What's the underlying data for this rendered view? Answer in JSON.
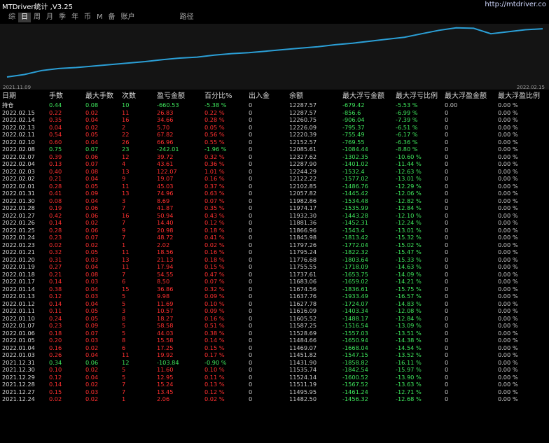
{
  "header": {
    "title": "MTDriver统计 ,V3.25",
    "url": "http://mtdriver.co"
  },
  "tabs": [
    {
      "label": "综"
    },
    {
      "label": "日"
    },
    {
      "label": "周"
    },
    {
      "label": "月"
    },
    {
      "label": "季"
    },
    {
      "label": "年"
    },
    {
      "label": "币"
    },
    {
      "label": "M"
    },
    {
      "label": "备"
    },
    {
      "label": "账户"
    },
    {
      "label": "路径"
    }
  ],
  "active_tab": "日",
  "chart": {
    "start_date": "2021.11.09",
    "end_date": "2022.02.15",
    "line_color": "#2b9fd6",
    "values": [
      0.0,
      0.05,
      0.13,
      0.17,
      0.19,
      0.22,
      0.25,
      0.28,
      0.31,
      0.35,
      0.38,
      0.4,
      0.44,
      0.47,
      0.49,
      0.52,
      0.55,
      0.58,
      0.61,
      0.65,
      0.68,
      0.72,
      0.76,
      0.8,
      0.87,
      0.94,
      0.99,
      0.98,
      0.87,
      0.91,
      0.95,
      0.97
    ]
  },
  "table": {
    "headers": [
      "日期",
      "手数",
      "最大手数",
      "次数",
      "盈亏金额",
      "百分比%",
      "出入金",
      "余额",
      "最大浮亏金额",
      "最大浮亏比例",
      "最大浮盈金额",
      "最大浮盈比例"
    ],
    "rows": [
      {
        "date": "持仓",
        "lots": "0.44",
        "maxlots": "0.08",
        "count": "10",
        "pnl": "-660.53",
        "pct": "-5.38 %",
        "io": "0",
        "bal": "12287.57",
        "mdd": "-679.42",
        "mddp": "-5.53 %",
        "mfe": "0.00",
        "mfep": "0.00 %",
        "hold": true
      },
      {
        "date": "2022.02.15",
        "lots": "0.22",
        "maxlots": "0.02",
        "count": "11",
        "pnl": "26.83",
        "pct": "0.22 %",
        "io": "0",
        "bal": "12287.57",
        "mdd": "-856.6",
        "mddp": "-6.99 %",
        "mfe": "0",
        "mfep": "0.00 %"
      },
      {
        "date": "2022.02.14",
        "lots": "0.35",
        "maxlots": "0.04",
        "count": "16",
        "pnl": "34.66",
        "pct": "0.28 %",
        "io": "0",
        "bal": "12260.75",
        "mdd": "-906.04",
        "mddp": "-7.39 %",
        "mfe": "0",
        "mfep": "0.00 %"
      },
      {
        "date": "2022.02.13",
        "lots": "0.04",
        "maxlots": "0.02",
        "count": "2",
        "pnl": "5.70",
        "pct": "0.05 %",
        "io": "0",
        "bal": "12226.09",
        "mdd": "-795.37",
        "mddp": "-6.51 %",
        "mfe": "0",
        "mfep": "0.00 %"
      },
      {
        "date": "2022.02.11",
        "lots": "0.54",
        "maxlots": "0.05",
        "count": "22",
        "pnl": "67.82",
        "pct": "0.56 %",
        "io": "0",
        "bal": "12220.39",
        "mdd": "-755.49",
        "mddp": "-6.17 %",
        "mfe": "0",
        "mfep": "0.00 %"
      },
      {
        "date": "2022.02.10",
        "lots": "0.60",
        "maxlots": "0.04",
        "count": "26",
        "pnl": "66.96",
        "pct": "0.55 %",
        "io": "0",
        "bal": "12152.57",
        "mdd": "-769.55",
        "mddp": "-6.36 %",
        "mfe": "0",
        "mfep": "0.00 %"
      },
      {
        "date": "2022.02.08",
        "lots": "0.75",
        "maxlots": "0.07",
        "count": "23",
        "pnl": "-242.01",
        "pct": "-1.96 %",
        "io": "0",
        "bal": "12085.61",
        "mdd": "-1084.44",
        "mddp": "-8.80 %",
        "mfe": "0",
        "mfep": "0.00 %"
      },
      {
        "date": "2022.02.07",
        "lots": "0.39",
        "maxlots": "0.06",
        "count": "12",
        "pnl": "39.72",
        "pct": "0.32 %",
        "io": "0",
        "bal": "12327.62",
        "mdd": "-1302.35",
        "mddp": "-10.60 %",
        "mfe": "0",
        "mfep": "0.00 %"
      },
      {
        "date": "2022.02.04",
        "lots": "0.13",
        "maxlots": "0.07",
        "count": "4",
        "pnl": "43.61",
        "pct": "0.36 %",
        "io": "0",
        "bal": "12287.90",
        "mdd": "-1401.02",
        "mddp": "-11.44 %",
        "mfe": "0",
        "mfep": "0.00 %"
      },
      {
        "date": "2022.02.03",
        "lots": "0.40",
        "maxlots": "0.08",
        "count": "13",
        "pnl": "122.07",
        "pct": "1.01 %",
        "io": "0",
        "bal": "12244.29",
        "mdd": "-1532.4",
        "mddp": "-12.63 %",
        "mfe": "0",
        "mfep": "0.00 %"
      },
      {
        "date": "2022.02.02",
        "lots": "0.21",
        "maxlots": "0.04",
        "count": "9",
        "pnl": "19.07",
        "pct": "0.16 %",
        "io": "0",
        "bal": "12122.22",
        "mdd": "-1577.02",
        "mddp": "-13.01 %",
        "mfe": "0",
        "mfep": "0.00 %"
      },
      {
        "date": "2022.02.01",
        "lots": "0.28",
        "maxlots": "0.05",
        "count": "11",
        "pnl": "45.03",
        "pct": "0.37 %",
        "io": "0",
        "bal": "12102.85",
        "mdd": "-1486.76",
        "mddp": "-12.29 %",
        "mfe": "0",
        "mfep": "0.00 %"
      },
      {
        "date": "2022.01.31",
        "lots": "0.41",
        "maxlots": "0.09",
        "count": "13",
        "pnl": "74.96",
        "pct": "0.63 %",
        "io": "0",
        "bal": "12057.82",
        "mdd": "-1445.42",
        "mddp": "-12.06 %",
        "mfe": "0",
        "mfep": "0.00 %"
      },
      {
        "date": "2022.01.30",
        "lots": "0.08",
        "maxlots": "0.04",
        "count": "3",
        "pnl": "8.69",
        "pct": "0.07 %",
        "io": "0",
        "bal": "11982.86",
        "mdd": "-1534.48",
        "mddp": "-12.82 %",
        "mfe": "0",
        "mfep": "0.00 %"
      },
      {
        "date": "2022.01.28",
        "lots": "0.19",
        "maxlots": "0.06",
        "count": "7",
        "pnl": "41.87",
        "pct": "0.35 %",
        "io": "0",
        "bal": "11974.17",
        "mdd": "-1535.99",
        "mddp": "-12.84 %",
        "mfe": "0",
        "mfep": "0.00 %"
      },
      {
        "date": "2022.01.27",
        "lots": "0.42",
        "maxlots": "0.06",
        "count": "16",
        "pnl": "50.94",
        "pct": "0.43 %",
        "io": "0",
        "bal": "11932.30",
        "mdd": "-1443.28",
        "mddp": "-12.10 %",
        "mfe": "0",
        "mfep": "0.00 %"
      },
      {
        "date": "2022.01.26",
        "lots": "0.14",
        "maxlots": "0.02",
        "count": "7",
        "pnl": "14.40",
        "pct": "0.12 %",
        "io": "0",
        "bal": "11881.36",
        "mdd": "-1452.31",
        "mddp": "-12.24 %",
        "mfe": "0",
        "mfep": "0.00 %"
      },
      {
        "date": "2022.01.25",
        "lots": "0.28",
        "maxlots": "0.06",
        "count": "9",
        "pnl": "20.98",
        "pct": "0.18 %",
        "io": "0",
        "bal": "11866.96",
        "mdd": "-1543.4",
        "mddp": "-13.01 %",
        "mfe": "0",
        "mfep": "0.00 %"
      },
      {
        "date": "2022.01.24",
        "lots": "0.23",
        "maxlots": "0.07",
        "count": "7",
        "pnl": "48.72",
        "pct": "0.41 %",
        "io": "0",
        "bal": "11845.98",
        "mdd": "-1813.42",
        "mddp": "-15.32 %",
        "mfe": "0",
        "mfep": "0.00 %"
      },
      {
        "date": "2022.01.23",
        "lots": "0.02",
        "maxlots": "0.02",
        "count": "1",
        "pnl": "2.02",
        "pct": "0.02 %",
        "io": "0",
        "bal": "11797.26",
        "mdd": "-1772.04",
        "mddp": "-15.02 %",
        "mfe": "0",
        "mfep": "0.00 %"
      },
      {
        "date": "2022.01.21",
        "lots": "0.32",
        "maxlots": "0.05",
        "count": "11",
        "pnl": "18.56",
        "pct": "0.16 %",
        "io": "0",
        "bal": "11795.24",
        "mdd": "-1822.32",
        "mddp": "-15.47 %",
        "mfe": "0",
        "mfep": "0.00 %"
      },
      {
        "date": "2022.01.20",
        "lots": "0.31",
        "maxlots": "0.03",
        "count": "13",
        "pnl": "21.13",
        "pct": "0.18 %",
        "io": "0",
        "bal": "11776.68",
        "mdd": "-1803.64",
        "mddp": "-15.33 %",
        "mfe": "0",
        "mfep": "0.00 %"
      },
      {
        "date": "2022.01.19",
        "lots": "0.27",
        "maxlots": "0.04",
        "count": "11",
        "pnl": "17.94",
        "pct": "0.15 %",
        "io": "0",
        "bal": "11755.55",
        "mdd": "-1718.09",
        "mddp": "-14.63 %",
        "mfe": "0",
        "mfep": "0.00 %"
      },
      {
        "date": "2022.01.18",
        "lots": "0.21",
        "maxlots": "0.08",
        "count": "7",
        "pnl": "54.55",
        "pct": "0.47 %",
        "io": "0",
        "bal": "11737.61",
        "mdd": "-1653.75",
        "mddp": "-14.09 %",
        "mfe": "0",
        "mfep": "0.00 %"
      },
      {
        "date": "2022.01.17",
        "lots": "0.14",
        "maxlots": "0.03",
        "count": "6",
        "pnl": "8.50",
        "pct": "0.07 %",
        "io": "0",
        "bal": "11683.06",
        "mdd": "-1659.02",
        "mddp": "-14.21 %",
        "mfe": "0",
        "mfep": "0.00 %"
      },
      {
        "date": "2022.01.14",
        "lots": "0.38",
        "maxlots": "0.04",
        "count": "15",
        "pnl": "36.86",
        "pct": "0.32 %",
        "io": "0",
        "bal": "11674.56",
        "mdd": "-1836.61",
        "mddp": "-15.75 %",
        "mfe": "0",
        "mfep": "0.00 %"
      },
      {
        "date": "2022.01.13",
        "lots": "0.12",
        "maxlots": "0.03",
        "count": "5",
        "pnl": "9.98",
        "pct": "0.09 %",
        "io": "0",
        "bal": "11637.76",
        "mdd": "-1933.49",
        "mddp": "-16.57 %",
        "mfe": "0",
        "mfep": "0.00 %"
      },
      {
        "date": "2022.01.12",
        "lots": "0.14",
        "maxlots": "0.04",
        "count": "5",
        "pnl": "11.69",
        "pct": "0.10 %",
        "io": "0",
        "bal": "11627.78",
        "mdd": "-1724.07",
        "mddp": "-14.83 %",
        "mfe": "0",
        "mfep": "0.00 %"
      },
      {
        "date": "2022.01.11",
        "lots": "0.11",
        "maxlots": "0.05",
        "count": "3",
        "pnl": "10.57",
        "pct": "0.09 %",
        "io": "0",
        "bal": "11616.09",
        "mdd": "-1403.34",
        "mddp": "-12.08 %",
        "mfe": "0",
        "mfep": "0.00 %"
      },
      {
        "date": "2022.01.10",
        "lots": "0.24",
        "maxlots": "0.05",
        "count": "8",
        "pnl": "18.27",
        "pct": "0.16 %",
        "io": "0",
        "bal": "11605.52",
        "mdd": "-1488.17",
        "mddp": "-12.84 %",
        "mfe": "0",
        "mfep": "0.00 %"
      },
      {
        "date": "2022.01.07",
        "lots": "0.23",
        "maxlots": "0.09",
        "count": "5",
        "pnl": "58.58",
        "pct": "0.51 %",
        "io": "0",
        "bal": "11587.25",
        "mdd": "-1516.54",
        "mddp": "-13.09 %",
        "mfe": "0",
        "mfep": "0.00 %"
      },
      {
        "date": "2022.01.06",
        "lots": "0.18",
        "maxlots": "0.07",
        "count": "5",
        "pnl": "44.03",
        "pct": "0.38 %",
        "io": "0",
        "bal": "11528.69",
        "mdd": "-1557.03",
        "mddp": "-13.51 %",
        "mfe": "0",
        "mfep": "0.00 %"
      },
      {
        "date": "2022.01.05",
        "lots": "0.20",
        "maxlots": "0.03",
        "count": "8",
        "pnl": "15.58",
        "pct": "0.14 %",
        "io": "0",
        "bal": "11484.66",
        "mdd": "-1650.94",
        "mddp": "-14.38 %",
        "mfe": "0",
        "mfep": "0.00 %"
      },
      {
        "date": "2022.01.04",
        "lots": "0.16",
        "maxlots": "0.02",
        "count": "6",
        "pnl": "17.25",
        "pct": "0.15 %",
        "io": "0",
        "bal": "11469.07",
        "mdd": "-1668.04",
        "mddp": "-14.54 %",
        "mfe": "0",
        "mfep": "0.00 %"
      },
      {
        "date": "2022.01.03",
        "lots": "0.26",
        "maxlots": "0.04",
        "count": "11",
        "pnl": "19.92",
        "pct": "0.17 %",
        "io": "0",
        "bal": "11451.82",
        "mdd": "-1547.15",
        "mddp": "-13.52 %",
        "mfe": "0",
        "mfep": "0.00 %"
      },
      {
        "date": "2021.12.31",
        "lots": "0.34",
        "maxlots": "0.06",
        "count": "12",
        "pnl": "-103.84",
        "pct": "-0.90 %",
        "io": "0",
        "bal": "11431.90",
        "mdd": "-1858.82",
        "mddp": "-16.11 %",
        "mfe": "0",
        "mfep": "0.00 %"
      },
      {
        "date": "2021.12.30",
        "lots": "0.10",
        "maxlots": "0.02",
        "count": "5",
        "pnl": "11.60",
        "pct": "0.10 %",
        "io": "0",
        "bal": "11535.74",
        "mdd": "-1842.54",
        "mddp": "-15.97 %",
        "mfe": "0",
        "mfep": "0.00 %"
      },
      {
        "date": "2021.12.29",
        "lots": "0.12",
        "maxlots": "0.04",
        "count": "5",
        "pnl": "12.95",
        "pct": "0.11 %",
        "io": "0",
        "bal": "11524.14",
        "mdd": "-1600.52",
        "mddp": "-13.90 %",
        "mfe": "0",
        "mfep": "0.00 %"
      },
      {
        "date": "2021.12.28",
        "lots": "0.14",
        "maxlots": "0.02",
        "count": "7",
        "pnl": "15.24",
        "pct": "0.13 %",
        "io": "0",
        "bal": "11511.19",
        "mdd": "-1567.52",
        "mddp": "-13.63 %",
        "mfe": "0",
        "mfep": "0.00 %"
      },
      {
        "date": "2021.12.27",
        "lots": "0.15",
        "maxlots": "0.03",
        "count": "7",
        "pnl": "13.45",
        "pct": "0.12 %",
        "io": "0",
        "bal": "11495.95",
        "mdd": "-1461.24",
        "mddp": "-12.71 %",
        "mfe": "0",
        "mfep": "0.00 %"
      },
      {
        "date": "2021.12.24",
        "lots": "0.02",
        "maxlots": "0.02",
        "count": "1",
        "pnl": "2.06",
        "pct": "0.02 %",
        "io": "0",
        "bal": "11482.50",
        "mdd": "-1456.32",
        "mddp": "-12.68 %",
        "mfe": "0",
        "mfep": "0.00 %"
      }
    ]
  }
}
